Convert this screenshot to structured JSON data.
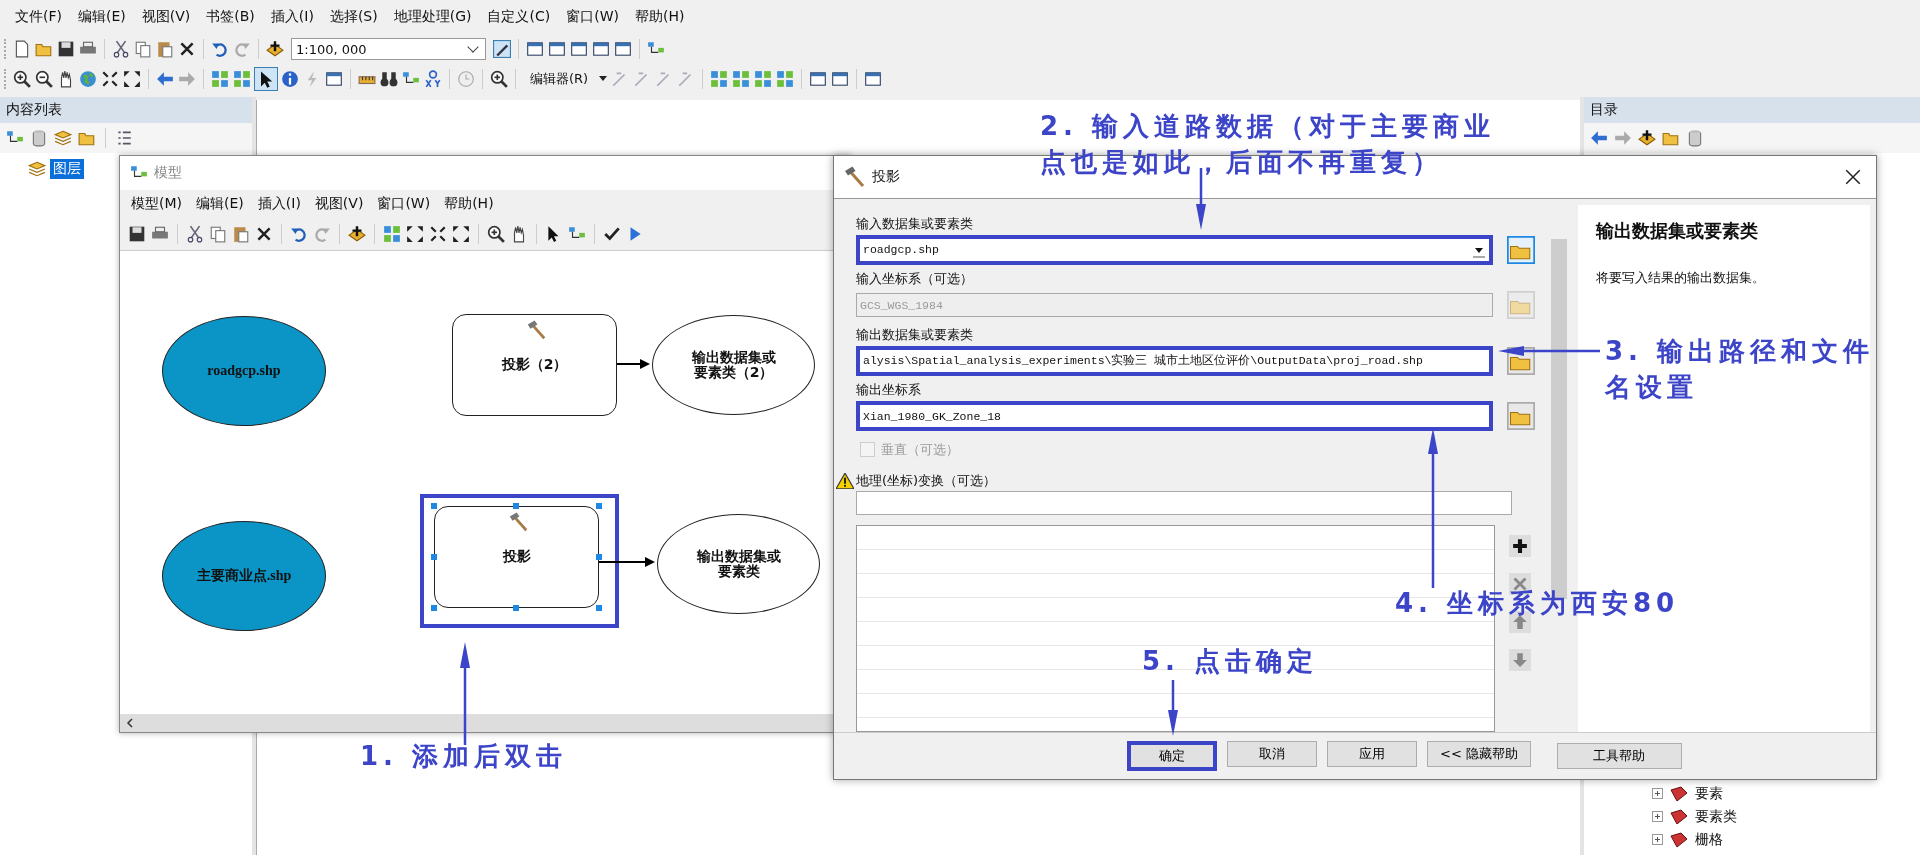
{
  "menu_bar": [
    "文件(F)",
    "编辑(E)",
    "视图(V)",
    "书签(B)",
    "插入(I)",
    "选择(S)",
    "地理处理(G)",
    "自定义(C)",
    "窗口(W)",
    "帮助(H)"
  ],
  "toolbar": {
    "scale": "1:100, 000",
    "editor_menu": "编辑器(R)",
    "select_tool_selected": true
  },
  "toc_panel": {
    "title": "内容列表",
    "items": [
      {
        "label": "图层",
        "selected": true
      }
    ]
  },
  "catalog_panel": {
    "title": "目录",
    "tree": [
      "要素",
      "要素类",
      "栅格"
    ]
  },
  "model_window": {
    "title": "模型",
    "menu": [
      "模型(M)",
      "编辑(E)",
      "插入(I)",
      "视图(V)",
      "窗口(W)",
      "帮助(H)"
    ],
    "rows": [
      {
        "input": "roadgcp.shp",
        "tool": "投影（2）",
        "output": "输出数据集或要素类（2）",
        "selected": false,
        "highlighted": false
      },
      {
        "input": "主要商业点.shp",
        "tool": "投影",
        "output": "输出数据集或要素类",
        "selected": true,
        "highlighted": true
      }
    ]
  },
  "dialog": {
    "title": "投影",
    "fields": [
      {
        "kind": "dropdown",
        "label": "输入数据集或要素类",
        "value": "roadgcp.shp",
        "disabled": false,
        "highlighted": true
      },
      {
        "kind": "text",
        "label": "输入坐标系（可选）",
        "value": "GCS_WGS_1984",
        "disabled": true,
        "highlighted": false
      },
      {
        "kind": "text",
        "label": "输出数据集或要素类",
        "value": "alysis\\Spatial_analysis_experiments\\实验三 城市土地区位评价\\OutputData\\proj_road.shp",
        "disabled": false,
        "highlighted": true
      },
      {
        "kind": "text",
        "label": "输出坐标系",
        "value": "Xian_1980_GK_Zone_18",
        "disabled": false,
        "highlighted": true
      },
      {
        "kind": "checkbox",
        "label": "垂直（可选）",
        "checked": false,
        "disabled": true
      },
      {
        "kind": "list",
        "label": "地理(坐标)变换（可选）",
        "warning": true
      }
    ],
    "buttons": [
      {
        "label": "确定",
        "highlighted": true
      },
      {
        "label": "取消",
        "highlighted": false
      },
      {
        "label": "应用",
        "highlighted": false
      },
      {
        "label": "<< 隐藏帮助",
        "highlighted": false
      }
    ],
    "help": {
      "title": "输出数据集或要素类",
      "text": "将要写入结果的输出数据集。",
      "button": "工具帮助"
    }
  },
  "annotations": [
    {
      "lines": [
        "1. 添加后双击"
      ]
    },
    {
      "lines": [
        "2. 输入道路数据（对于主要商业",
        "点也是如此，后面不再重复）"
      ]
    },
    {
      "lines": [
        "3. 输出路径和文件",
        "名设置"
      ]
    },
    {
      "lines": [
        "4. 坐标系为西安80"
      ]
    },
    {
      "lines": [
        "5. 点击确定"
      ]
    }
  ]
}
